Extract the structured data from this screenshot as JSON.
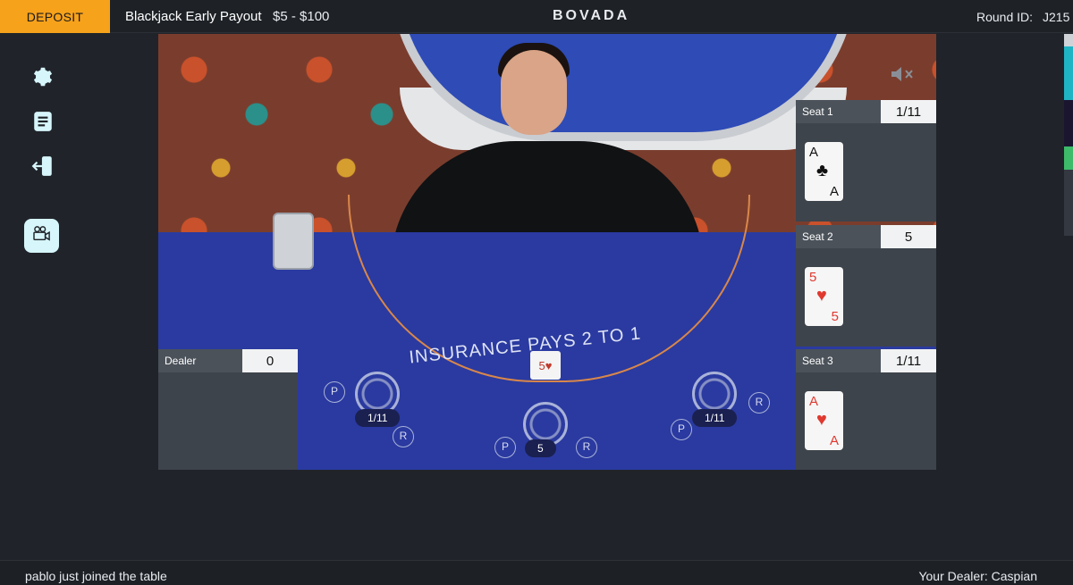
{
  "header": {
    "deposit_label": "DEPOSIT",
    "table_name": "Blackjack Early Payout",
    "limits": "$5 - $100",
    "brand": "BOVADA",
    "round_label": "Round ID:",
    "round_value": "J215"
  },
  "sidebar": {
    "icons": [
      "gear-icon",
      "document-icon",
      "exit-icon",
      "video-camera-icon"
    ]
  },
  "table": {
    "insurance_text": "INSURANCE PAYS 2 TO 1",
    "spots": [
      {
        "tag": "1/11"
      },
      {
        "tag": "5"
      },
      {
        "tag": "1/11"
      }
    ],
    "pr_labels": {
      "p": "P",
      "r": "R"
    },
    "felt_card_center": "5",
    "felt_card_center_suit": "♥"
  },
  "dealer_panel": {
    "title": "Dealer",
    "score": "0"
  },
  "seats": [
    {
      "title": "Seat 1",
      "score": "1/11",
      "rank": "A",
      "suit": "♣",
      "color": "#111111"
    },
    {
      "title": "Seat 2",
      "score": "5",
      "rank": "5",
      "suit": "♥",
      "color": "#e0392f"
    },
    {
      "title": "Seat 3",
      "score": "1/11",
      "rank": "A",
      "suit": "♥",
      "color": "#e0392f"
    }
  ],
  "footer": {
    "message": "pablo just joined the table",
    "dealer": "Your Dealer: Caspian"
  },
  "colors": {
    "accent": "#f7a21b",
    "felt": "#2a3aa0",
    "panel": "#3e444c"
  }
}
